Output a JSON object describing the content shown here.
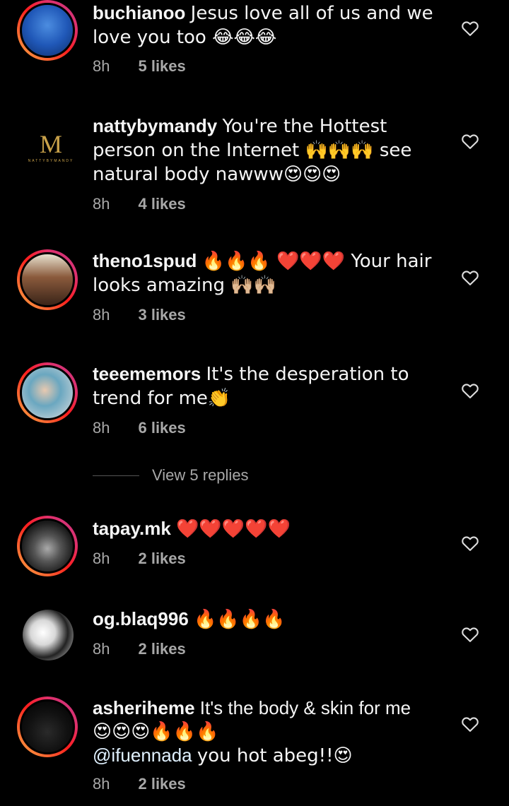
{
  "comments": [
    {
      "username": "buchianoo",
      "text": "Jesus love all of us and we love you too 😂😂😂",
      "time": "8h",
      "likes": "5 likes"
    },
    {
      "username": "nattybymandy",
      "text": "You're the Hottest person on the Internet 🙌🙌🙌 see natural body nawww😍😍😍",
      "time": "8h",
      "likes": "4 likes",
      "logo_letter": "M",
      "logo_word": "NATTYBYMANDY"
    },
    {
      "username": "theno1spud",
      "text": "🔥🔥🔥 ❤️❤️❤️ Your hair looks amazing 🙌🏼🙌🏼",
      "time": "8h",
      "likes": "3 likes"
    },
    {
      "username": "teeememors",
      "text": "It's the desperation to trend for me👏",
      "time": "8h",
      "likes": "6 likes",
      "view_replies": "View 5 replies"
    },
    {
      "username": "tapay.mk",
      "text": "❤️❤️❤️❤️❤️",
      "time": "8h",
      "likes": "2 likes"
    },
    {
      "username": "og.blaq996",
      "text": "🔥🔥🔥🔥",
      "time": "8h",
      "likes": "2 likes"
    },
    {
      "username": "asheriheme",
      "text_line1": "It's the body & skin for me",
      "text_line2": "😍😍😍🔥🔥🔥",
      "mention": "@ifuennada",
      "text_line3": "you hot abeg!!😍",
      "time": "8h",
      "likes": "2 likes"
    }
  ],
  "icons": {
    "like": "heart-outline-icon"
  },
  "colors": {
    "background": "#000000",
    "text": "#f5f5f5",
    "meta": "#a8a8a8",
    "story_ring": "#e1306c"
  }
}
